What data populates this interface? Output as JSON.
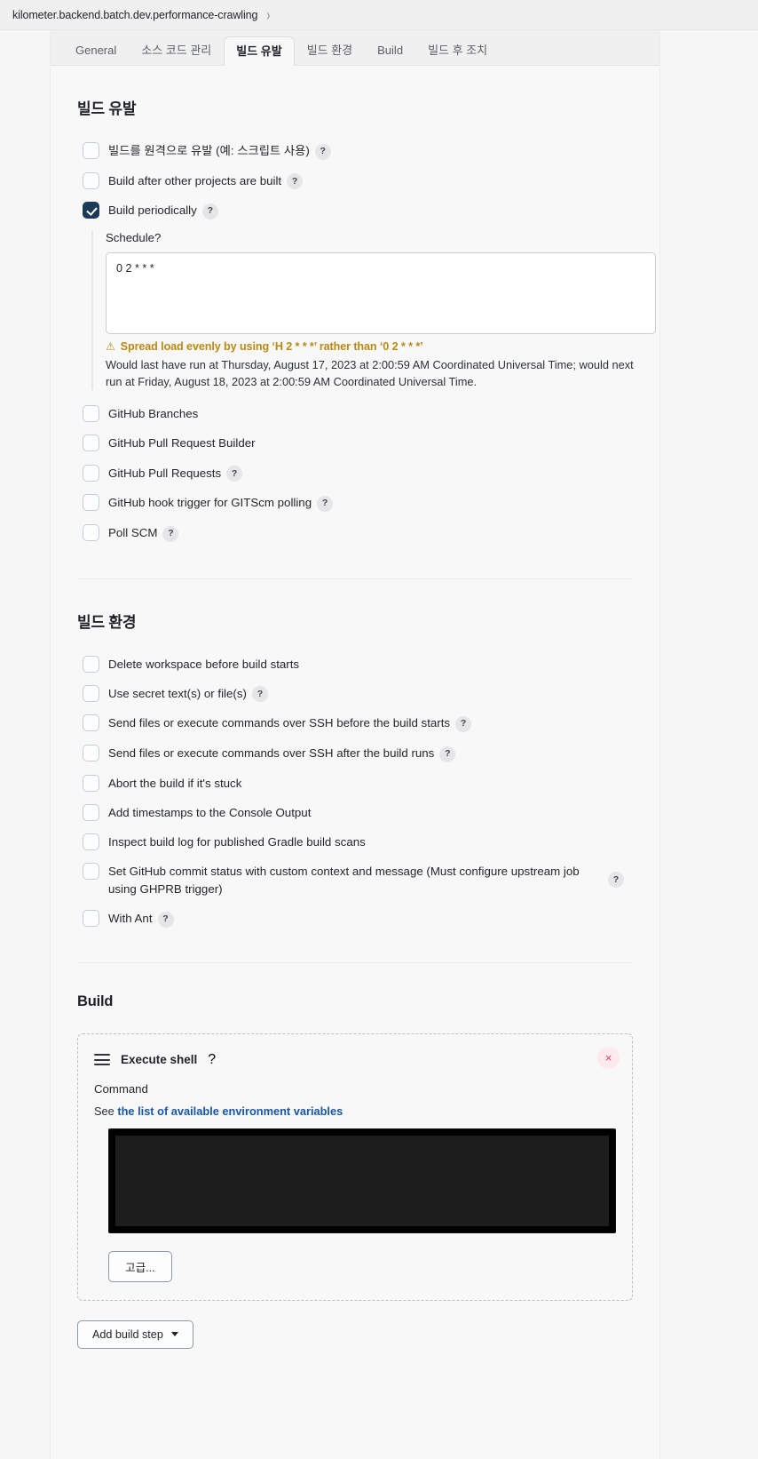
{
  "breadcrumb": {
    "job_name": "kilometer.backend.batch.dev.performance-crawling",
    "separator": "›"
  },
  "tabs": [
    {
      "label": "General",
      "active": false
    },
    {
      "label": "소스 코드 관리",
      "active": false
    },
    {
      "label": "빌드 유발",
      "active": true
    },
    {
      "label": "빌드 환경",
      "active": false
    },
    {
      "label": "Build",
      "active": false
    },
    {
      "label": "빌드 후 조치",
      "active": false
    }
  ],
  "help_glyph": "?",
  "build_triggers": {
    "title": "빌드 유발",
    "items": [
      {
        "label": "빌드를 원격으로 유발 (예: 스크립트 사용)",
        "checked": false,
        "help": true
      },
      {
        "label": "Build after other projects are built",
        "checked": false,
        "help": true
      },
      {
        "label": "Build periodically",
        "checked": true,
        "help": true
      }
    ],
    "schedule": {
      "label": "Schedule",
      "help": true,
      "value": "0 2 * * *",
      "warning": "Spread load evenly by using ‘H 2 * * *’ rather than ‘0 2 * * *’",
      "warning_icon": "⚠",
      "info": "Would last have run at Thursday, August 17, 2023 at 2:00:59 AM Coordinated Universal Time; would next run at Friday, August 18, 2023 at 2:00:59 AM Coordinated Universal Time."
    },
    "items_after": [
      {
        "label": "GitHub Branches",
        "checked": false,
        "help": false
      },
      {
        "label": "GitHub Pull Request Builder",
        "checked": false,
        "help": false
      },
      {
        "label": "GitHub Pull Requests",
        "checked": false,
        "help": true
      },
      {
        "label": "GitHub hook trigger for GITScm polling",
        "checked": false,
        "help": true
      },
      {
        "label": "Poll SCM",
        "checked": false,
        "help": true
      }
    ]
  },
  "build_environment": {
    "title": "빌드 환경",
    "items": [
      {
        "label": "Delete workspace before build starts",
        "checked": false,
        "help": false
      },
      {
        "label": "Use secret text(s) or file(s)",
        "checked": false,
        "help": true
      },
      {
        "label": "Send files or execute commands over SSH before the build starts",
        "checked": false,
        "help": true
      },
      {
        "label": "Send files or execute commands over SSH after the build runs",
        "checked": false,
        "help": true
      },
      {
        "label": "Abort the build if it's stuck",
        "checked": false,
        "help": false
      },
      {
        "label": "Add timestamps to the Console Output",
        "checked": false,
        "help": false
      },
      {
        "label": "Inspect build log for published Gradle build scans",
        "checked": false,
        "help": false
      },
      {
        "label": "Set GitHub commit status with custom context and message (Must configure upstream job using GHPRB trigger)",
        "checked": false,
        "help": true,
        "help_right": true
      },
      {
        "label": "With Ant",
        "checked": false,
        "help": true
      }
    ]
  },
  "build": {
    "title": "Build",
    "step": {
      "name": "Execute shell",
      "help": true,
      "close_glyph": "×",
      "command_label": "Command",
      "env_prefix": "See ",
      "env_link": "the list of available environment variables",
      "command_value": "",
      "advanced_button": "고급..."
    },
    "add_build_step_button": "Add build step"
  }
}
